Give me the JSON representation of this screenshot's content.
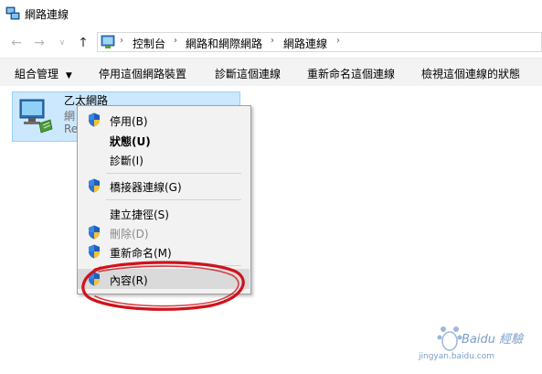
{
  "window": {
    "title": "網路連線"
  },
  "address": {
    "crumbs": [
      "控制台",
      "網路和網際網路",
      "網路連線"
    ]
  },
  "commands": {
    "organize": "組合管理",
    "disable": "停用這個網路裝置",
    "diagnose": "診斷這個連線",
    "rename": "重新命名這個連線",
    "view_status": "檢視這個連線的狀態"
  },
  "item": {
    "name": "乙太網路",
    "sub1": "網",
    "sub2": "Re"
  },
  "menu": {
    "items": [
      {
        "label": "停用(B)",
        "shield": true,
        "disabled": false
      },
      {
        "label": "狀態(U)",
        "shield": false,
        "disabled": false
      },
      {
        "label": "診斷(I)",
        "shield": false,
        "disabled": false
      },
      {
        "label": "橋接器連線(G)",
        "shield": true,
        "disabled": false
      },
      {
        "label": "建立捷徑(S)",
        "shield": false,
        "disabled": false
      },
      {
        "label": "刪除(D)",
        "shield": true,
        "disabled": true
      },
      {
        "label": "重新命名(M)",
        "shield": true,
        "disabled": false
      },
      {
        "label": "內容(R)",
        "shield": true,
        "disabled": false,
        "highlighted": true
      }
    ]
  },
  "watermark": {
    "brand": "Baidu 經驗",
    "url": "jingyan.baidu.com"
  },
  "colors": {
    "selection": "#cce8ff",
    "annotation": "#d0121b"
  }
}
